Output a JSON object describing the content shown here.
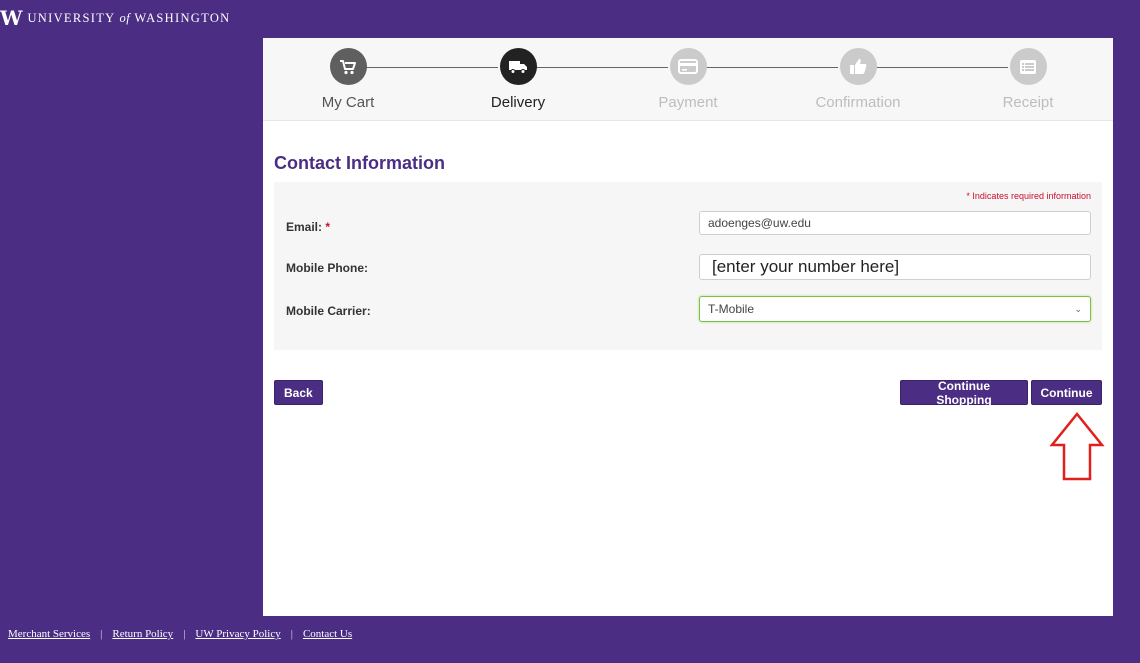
{
  "header": {
    "logo_mark": "W",
    "logo_text_before": "UNIVERSITY",
    "logo_text_of": "of",
    "logo_text_after": "WASHINGTON"
  },
  "stepper": {
    "steps": [
      {
        "label": "My Cart",
        "icon": "cart-icon",
        "state": "done"
      },
      {
        "label": "Delivery",
        "icon": "truck-icon",
        "state": "active"
      },
      {
        "label": "Payment",
        "icon": "credit-card-icon",
        "state": "todo"
      },
      {
        "label": "Confirmation",
        "icon": "thumbs-up-icon",
        "state": "todo"
      },
      {
        "label": "Receipt",
        "icon": "list-icon",
        "state": "todo"
      }
    ]
  },
  "contact": {
    "title": "Contact Information",
    "required_note": "* Indicates required information",
    "email_label": "Email:",
    "required_star": "*",
    "email_value": "adoenges@uw.edu",
    "phone_label": "Mobile Phone:",
    "phone_value": "[enter your number here]",
    "carrier_label": "Mobile Carrier:",
    "carrier_value": "T-Mobile"
  },
  "buttons": {
    "back": "Back",
    "continue_shopping": "Continue Shopping",
    "continue": "Continue"
  },
  "footer": {
    "links": [
      "Merchant Services",
      "Return Policy",
      "UW Privacy Policy",
      "Contact Us"
    ],
    "separator": "|"
  },
  "colors": {
    "brand_purple": "#4b2e83",
    "required_red": "#c8102e",
    "focus_green": "#7bc142",
    "annotation_red": "#e0201c"
  }
}
